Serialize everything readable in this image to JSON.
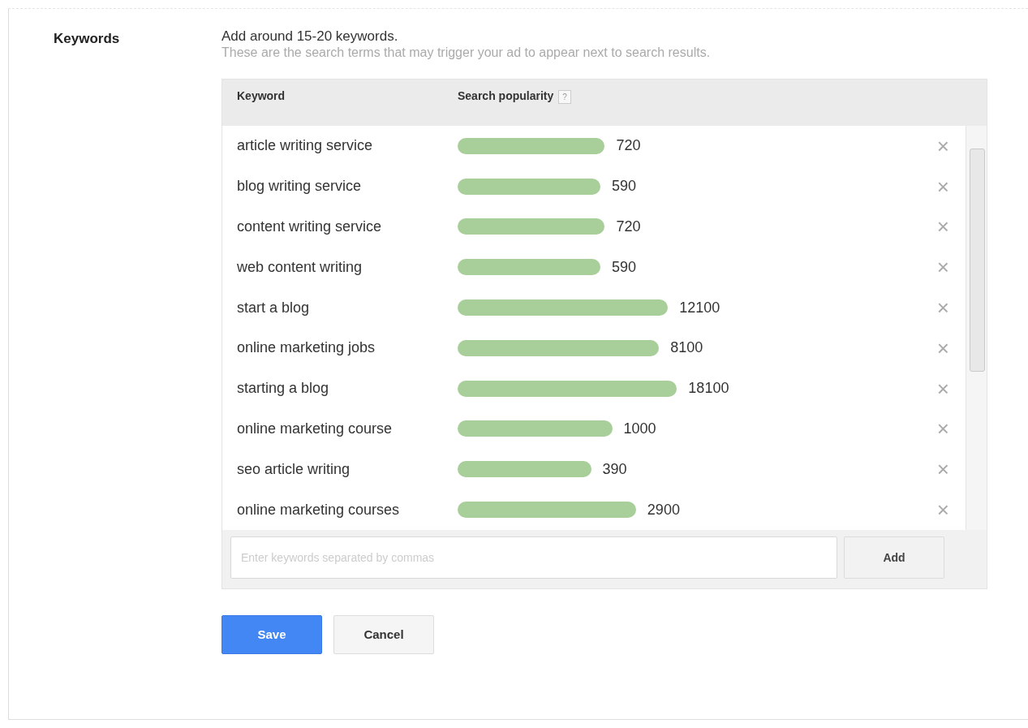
{
  "section_label": "Keywords",
  "instruction": "Add around 15-20 keywords.",
  "description": "These are the search terms that may trigger your ad to appear next to search results.",
  "table": {
    "columns": [
      {
        "label": "Keyword"
      },
      {
        "label": "Search popularity",
        "help": "?"
      }
    ],
    "rows": [
      {
        "keyword": "article writing service",
        "volume": "720",
        "remove": "×"
      },
      {
        "keyword": "blog writing service",
        "volume": "590",
        "remove": "×"
      },
      {
        "keyword": "content writing service",
        "volume": "720",
        "remove": "×"
      },
      {
        "keyword": "web content writing",
        "volume": "590",
        "remove": "×"
      },
      {
        "keyword": "start a blog",
        "volume": "12100",
        "remove": "×"
      },
      {
        "keyword": "online marketing jobs",
        "volume": "8100",
        "remove": "×"
      },
      {
        "keyword": "starting a blog",
        "volume": "18100",
        "remove": "×"
      },
      {
        "keyword": "online marketing course",
        "volume": "1000",
        "remove": "×"
      },
      {
        "keyword": "seo article writing",
        "volume": "390",
        "remove": "×"
      },
      {
        "keyword": "online marketing courses",
        "volume": "2900",
        "remove": "×"
      }
    ]
  },
  "add_field": {
    "placeholder": "Enter keywords separated by commas"
  },
  "add_button": "Add",
  "buttons": [
    {
      "label": "Save",
      "kind": "primary"
    },
    {
      "label": "Cancel",
      "kind": "secondary"
    }
  ]
}
